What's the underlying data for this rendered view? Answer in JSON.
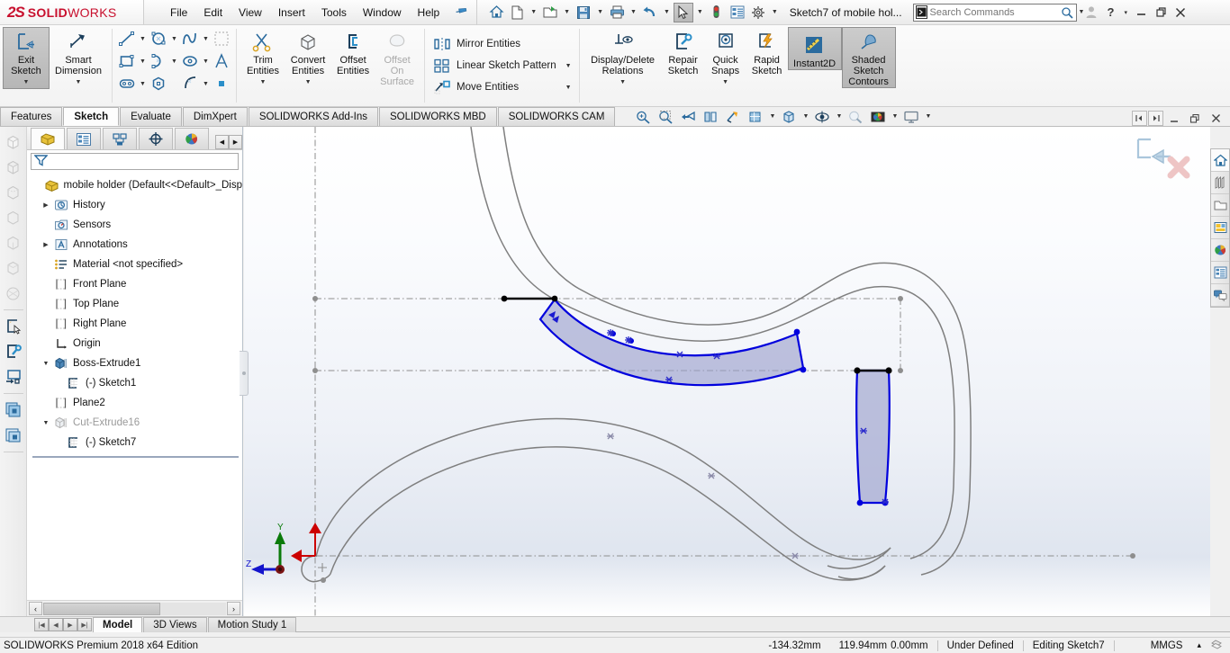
{
  "app": {
    "brand_ds": "2S",
    "brand_name1": "SOLID",
    "brand_name2": "WORKS",
    "document_title": "Sketch7 of mobile hol...",
    "edition": "SOLIDWORKS Premium 2018 x64 Edition",
    "accent_red": "#c8102e",
    "sketch_blue": "#0000dd",
    "construction_gray": "#808080"
  },
  "menu": {
    "items": [
      {
        "label": "File",
        "name": "menu-file"
      },
      {
        "label": "Edit",
        "name": "menu-edit"
      },
      {
        "label": "View",
        "name": "menu-view"
      },
      {
        "label": "Insert",
        "name": "menu-insert"
      },
      {
        "label": "Tools",
        "name": "menu-tools"
      },
      {
        "label": "Window",
        "name": "menu-window"
      },
      {
        "label": "Help",
        "name": "menu-help"
      }
    ],
    "pin_icon": "pushpin-icon"
  },
  "quick_access": [
    {
      "name": "home-icon",
      "has_caret": false
    },
    {
      "name": "new-document-icon",
      "has_caret": true
    },
    {
      "name": "open-folder-icon",
      "has_caret": true
    },
    {
      "name": "save-icon",
      "has_caret": true
    },
    {
      "name": "print-icon",
      "has_caret": true
    },
    {
      "name": "undo-icon",
      "has_caret": true
    },
    {
      "name": "select-cursor-icon",
      "has_caret": true,
      "pressed": true
    },
    {
      "name": "rebuild-traffic-light-icon",
      "has_caret": false
    },
    {
      "name": "options-list-icon",
      "has_caret": false
    },
    {
      "name": "settings-gear-icon",
      "has_caret": true
    }
  ],
  "search": {
    "placeholder": "Search Commands",
    "value": "",
    "icon": "command-search-icon",
    "magnifier": "magnifier-icon"
  },
  "window_controls": {
    "account": "user-account-icon",
    "help": "?",
    "help_caret": "▾",
    "minimize": "minimize-icon",
    "restore": "restore-icon",
    "close": "close-icon"
  },
  "ribbon": {
    "groups": [
      {
        "name": "sketch-mode-group",
        "buttons": [
          {
            "label": "Exit\nSketch",
            "name": "exit-sketch-button",
            "icon": "exit-sketch-icon",
            "dropdown": true,
            "state": "active"
          },
          {
            "label": "Smart\nDimension",
            "name": "smart-dimension-button",
            "icon": "smart-dimension-icon",
            "dropdown": true,
            "state": "normal"
          }
        ]
      },
      {
        "name": "sketch-entities-grid",
        "rows": [
          [
            {
              "name": "line-tool",
              "icon": "line-icon",
              "caret": true
            },
            {
              "name": "circle-tool",
              "icon": "circle-icon",
              "caret": true
            },
            {
              "name": "spline-tool",
              "icon": "spline-icon",
              "caret": true
            },
            {
              "name": "sketch-pattern-tool",
              "icon": "dashed-square-icon",
              "caret": false,
              "disabled": true
            }
          ],
          [
            {
              "name": "rectangle-tool",
              "icon": "rectangle-icon",
              "caret": true
            },
            {
              "name": "arc-tool",
              "icon": "arc-icon",
              "caret": true
            },
            {
              "name": "ellipse-tool",
              "icon": "ellipse-icon",
              "caret": true
            },
            {
              "name": "text-tool",
              "icon": "text-A-icon",
              "caret": false
            }
          ],
          [
            {
              "name": "slot-tool",
              "icon": "slot-icon",
              "caret": true
            },
            {
              "name": "polygon-tool",
              "icon": "polygon-icon",
              "caret": false
            },
            {
              "name": "fillet-tool",
              "icon": "sketch-fillet-icon",
              "caret": true
            },
            {
              "name": "point-tool",
              "icon": "point-square-icon",
              "caret": false
            }
          ]
        ]
      },
      {
        "name": "edit-entities-group",
        "buttons": [
          {
            "label": "Trim\nEntities",
            "name": "trim-entities-button",
            "icon": "trim-entities-icon",
            "dropdown": true,
            "state": "normal"
          },
          {
            "label": "Convert\nEntities",
            "name": "convert-entities-button",
            "icon": "convert-entities-icon",
            "dropdown": true,
            "state": "normal"
          },
          {
            "label": "Offset\nEntities",
            "name": "offset-entities-button",
            "icon": "offset-entities-icon",
            "dropdown": false,
            "state": "normal"
          },
          {
            "label": "Offset\nOn\nSurface",
            "name": "offset-on-surface-button",
            "icon": "offset-on-surface-icon",
            "dropdown": false,
            "state": "disabled"
          }
        ]
      },
      {
        "name": "pattern-tools-list",
        "rows": [
          {
            "label": "Mirror Entities",
            "name": "mirror-entities-item",
            "icon": "mirror-entities-icon",
            "caret": false
          },
          {
            "label": "Linear Sketch Pattern",
            "name": "linear-sketch-pattern-item",
            "icon": "linear-pattern-icon",
            "caret": true
          },
          {
            "label": "Move Entities",
            "name": "move-entities-item",
            "icon": "move-entities-icon",
            "caret": true
          }
        ]
      },
      {
        "name": "relations-display-group",
        "buttons": [
          {
            "label": "Display/Delete\nRelations",
            "name": "display-delete-relations-button",
            "icon": "display-delete-relations-icon",
            "dropdown": true,
            "state": "normal"
          },
          {
            "label": "Repair\nSketch",
            "name": "repair-sketch-button",
            "icon": "repair-sketch-icon",
            "dropdown": false,
            "state": "normal"
          },
          {
            "label": "Quick\nSnaps",
            "name": "quick-snaps-button",
            "icon": "quick-snaps-icon",
            "dropdown": true,
            "state": "normal"
          },
          {
            "label": "Rapid\nSketch",
            "name": "rapid-sketch-button",
            "icon": "rapid-sketch-icon",
            "dropdown": false,
            "state": "normal"
          },
          {
            "label": "Instant2D",
            "name": "instant2d-button",
            "icon": "instant2d-icon",
            "dropdown": false,
            "state": "active"
          },
          {
            "label": "Shaded\nSketch\nContours",
            "name": "shaded-sketch-contours-button",
            "icon": "shaded-sketch-contours-icon",
            "dropdown": false,
            "state": "active"
          }
        ]
      }
    ]
  },
  "ribbon_tabs": [
    {
      "label": "Features",
      "name": "tab-features",
      "selected": false
    },
    {
      "label": "Sketch",
      "name": "tab-sketch",
      "selected": true
    },
    {
      "label": "Evaluate",
      "name": "tab-evaluate",
      "selected": false
    },
    {
      "label": "DimXpert",
      "name": "tab-dimxpert",
      "selected": false
    },
    {
      "label": "SOLIDWORKS Add-Ins",
      "name": "tab-solidworks-add-ins",
      "selected": false
    },
    {
      "label": "SOLIDWORKS MBD",
      "name": "tab-solidworks-mbd",
      "selected": false
    },
    {
      "label": "SOLIDWORKS CAM",
      "name": "tab-solidworks-cam",
      "selected": false
    }
  ],
  "heads_up_toolbar": [
    {
      "name": "zoom-to-fit-icon",
      "caret": false
    },
    {
      "name": "zoom-to-area-icon",
      "caret": false
    },
    {
      "name": "previous-view-icon",
      "caret": false
    },
    {
      "name": "section-view-icon",
      "caret": false
    },
    {
      "name": "view-orientation-icon",
      "caret": false
    },
    {
      "name": "view-orientation-cube-icon",
      "caret": true
    },
    {
      "name": "display-style-icon",
      "caret": true
    },
    {
      "name": "hide-show-items-icon",
      "caret": true
    },
    {
      "name": "edit-appearance-icon",
      "caret": false
    },
    {
      "name": "apply-scene-icon",
      "caret": true
    },
    {
      "name": "view-settings-icon",
      "caret": true
    }
  ],
  "viewport_window_controls": {
    "prev": "restore-left-icon",
    "next": "restore-right-icon",
    "minimize": "minimize-icon",
    "restore": "restore-icon",
    "close": "close-icon"
  },
  "confirmation_corner": {
    "accept": "exit-sketch-corner-icon",
    "cancel": "cancel-red-x-icon"
  },
  "left_rail": [
    {
      "name": "rail-item-1",
      "icon": "shaded-cube-icon",
      "dim": true
    },
    {
      "name": "rail-item-2",
      "icon": "wireframe-cube-icon",
      "dim": true
    },
    {
      "name": "rail-item-3",
      "icon": "hidden-lines-cube-icon",
      "dim": true
    },
    {
      "name": "rail-item-4",
      "icon": "hidden-removed-cube-icon",
      "dim": true
    },
    {
      "name": "rail-item-5",
      "icon": "shaded-edges-cube-icon",
      "dim": true
    },
    {
      "name": "rail-item-6",
      "icon": "shaded-cube2-icon",
      "dim": true
    },
    {
      "name": "rail-item-7",
      "icon": "perspective-cube-icon",
      "dim": true
    },
    {
      "name": "rail-item-8",
      "icon": "new-sketch-select-icon",
      "dim": false
    },
    {
      "name": "rail-item-9",
      "icon": "repair-sketch-rail-icon",
      "dim": false
    },
    {
      "name": "rail-item-10",
      "icon": "move-to-screen-icon",
      "dim": false
    },
    {
      "name": "rail-item-11",
      "icon": "multiple-configs-icon",
      "dim": false
    },
    {
      "name": "rail-item-12",
      "icon": "configuration-icon",
      "dim": false
    }
  ],
  "feature_manager": {
    "tabs": [
      {
        "name": "fm-tab-feature-tree",
        "icon": "yellow-part-icon",
        "selected": true
      },
      {
        "name": "fm-tab-property-manager",
        "icon": "property-manager-icon",
        "selected": false
      },
      {
        "name": "fm-tab-configuration-manager",
        "icon": "configuration-manager-icon",
        "selected": false
      },
      {
        "name": "fm-tab-dimxpert-manager",
        "icon": "dimxpert-target-icon",
        "selected": false
      },
      {
        "name": "fm-tab-display-manager",
        "icon": "display-manager-sphere-icon",
        "selected": false
      }
    ],
    "nav_prev": "◀",
    "nav_next": "▶",
    "filter_icon": "filter-funnel-icon",
    "filter_placeholder": "",
    "tree": [
      {
        "label": "mobile holder  (Default<<Default>_Disp",
        "name": "tree-item-part-root",
        "icon": "yellow-part-icon",
        "indent": 0,
        "twist": "",
        "dim": false
      },
      {
        "label": "History",
        "name": "tree-item-history",
        "icon": "history-icon",
        "indent": 1,
        "twist": "▶",
        "dim": false
      },
      {
        "label": "Sensors",
        "name": "tree-item-sensors",
        "icon": "sensors-icon",
        "indent": 1,
        "twist": "",
        "dim": false
      },
      {
        "label": "Annotations",
        "name": "tree-item-annotations",
        "icon": "annotations-icon",
        "indent": 1,
        "twist": "▶",
        "dim": false
      },
      {
        "label": "Material <not specified>",
        "name": "tree-item-material",
        "icon": "material-icon",
        "indent": 1,
        "twist": "",
        "dim": false
      },
      {
        "label": "Front Plane",
        "name": "tree-item-front-plane",
        "icon": "plane-icon",
        "indent": 1,
        "twist": "",
        "dim": false
      },
      {
        "label": "Top Plane",
        "name": "tree-item-top-plane",
        "icon": "plane-icon",
        "indent": 1,
        "twist": "",
        "dim": false
      },
      {
        "label": "Right Plane",
        "name": "tree-item-right-plane",
        "icon": "plane-icon",
        "indent": 1,
        "twist": "",
        "dim": false
      },
      {
        "label": "Origin",
        "name": "tree-item-origin",
        "icon": "origin-icon",
        "indent": 1,
        "twist": "",
        "dim": false
      },
      {
        "label": "Boss-Extrude1",
        "name": "tree-item-boss-extrude1",
        "icon": "boss-extrude-icon",
        "indent": 1,
        "twist": "▼",
        "dim": false
      },
      {
        "label": "(-) Sketch1",
        "name": "tree-item-sketch1",
        "icon": "sketch-icon",
        "indent": 2,
        "twist": "",
        "dim": false
      },
      {
        "label": "Plane2",
        "name": "tree-item-plane2",
        "icon": "plane-icon",
        "indent": 1,
        "twist": "",
        "dim": false
      },
      {
        "label": "Cut-Extrude16",
        "name": "tree-item-cut-extrude16",
        "icon": "cut-extrude-icon",
        "indent": 1,
        "twist": "▼",
        "dim": true
      },
      {
        "label": "(-) Sketch7",
        "name": "tree-item-sketch7",
        "icon": "sketch-icon",
        "indent": 2,
        "twist": "",
        "dim": false
      }
    ]
  },
  "task_pane": [
    {
      "name": "task-pane-resources",
      "icon": "sw-resources-home-icon",
      "selected": true
    },
    {
      "name": "task-pane-design-library",
      "icon": "design-library-icon",
      "selected": false
    },
    {
      "name": "task-pane-file-explorer",
      "icon": "file-explorer-folder-icon",
      "selected": false
    },
    {
      "name": "task-pane-view-palette",
      "icon": "view-palette-icon",
      "selected": false
    },
    {
      "name": "task-pane-appearances",
      "icon": "appearances-sphere-icon",
      "selected": false
    },
    {
      "name": "task-pane-custom-properties",
      "icon": "custom-properties-icon",
      "selected": false
    },
    {
      "name": "task-pane-solidworks-forum",
      "icon": "forum-chat-icon",
      "selected": false
    }
  ],
  "bottom_tabs": [
    {
      "label": "Model",
      "name": "bottom-tab-model",
      "selected": true
    },
    {
      "label": "3D Views",
      "name": "bottom-tab-3d-views",
      "selected": false
    },
    {
      "label": "Motion Study 1",
      "name": "bottom-tab-motion-study-1",
      "selected": false
    }
  ],
  "status_bar": {
    "left": "SOLIDWORKS Premium 2018 x64 Edition",
    "coord_x": "-134.32mm",
    "coord_y": "119.94mm",
    "coord_z": "0.00mm",
    "state": "Under Defined",
    "editing": "Editing Sketch7",
    "units": "MMGS",
    "units_caret": "▴",
    "overlay_icon": "overlay-icon"
  },
  "axis_triad": {
    "x_label": "Z",
    "y_label": "Y",
    "x_color": "#0000cc",
    "y_color": "#008800",
    "origin_color": "#7a1414"
  },
  "sketch": {
    "selected_entities_color": "#0000dd",
    "shaded_contour_fill": "#9a9ecc",
    "construction_line_color": "#7f7f7f",
    "black_edge_color": "#000000",
    "relation_marker": "relation-coincident-icon"
  }
}
